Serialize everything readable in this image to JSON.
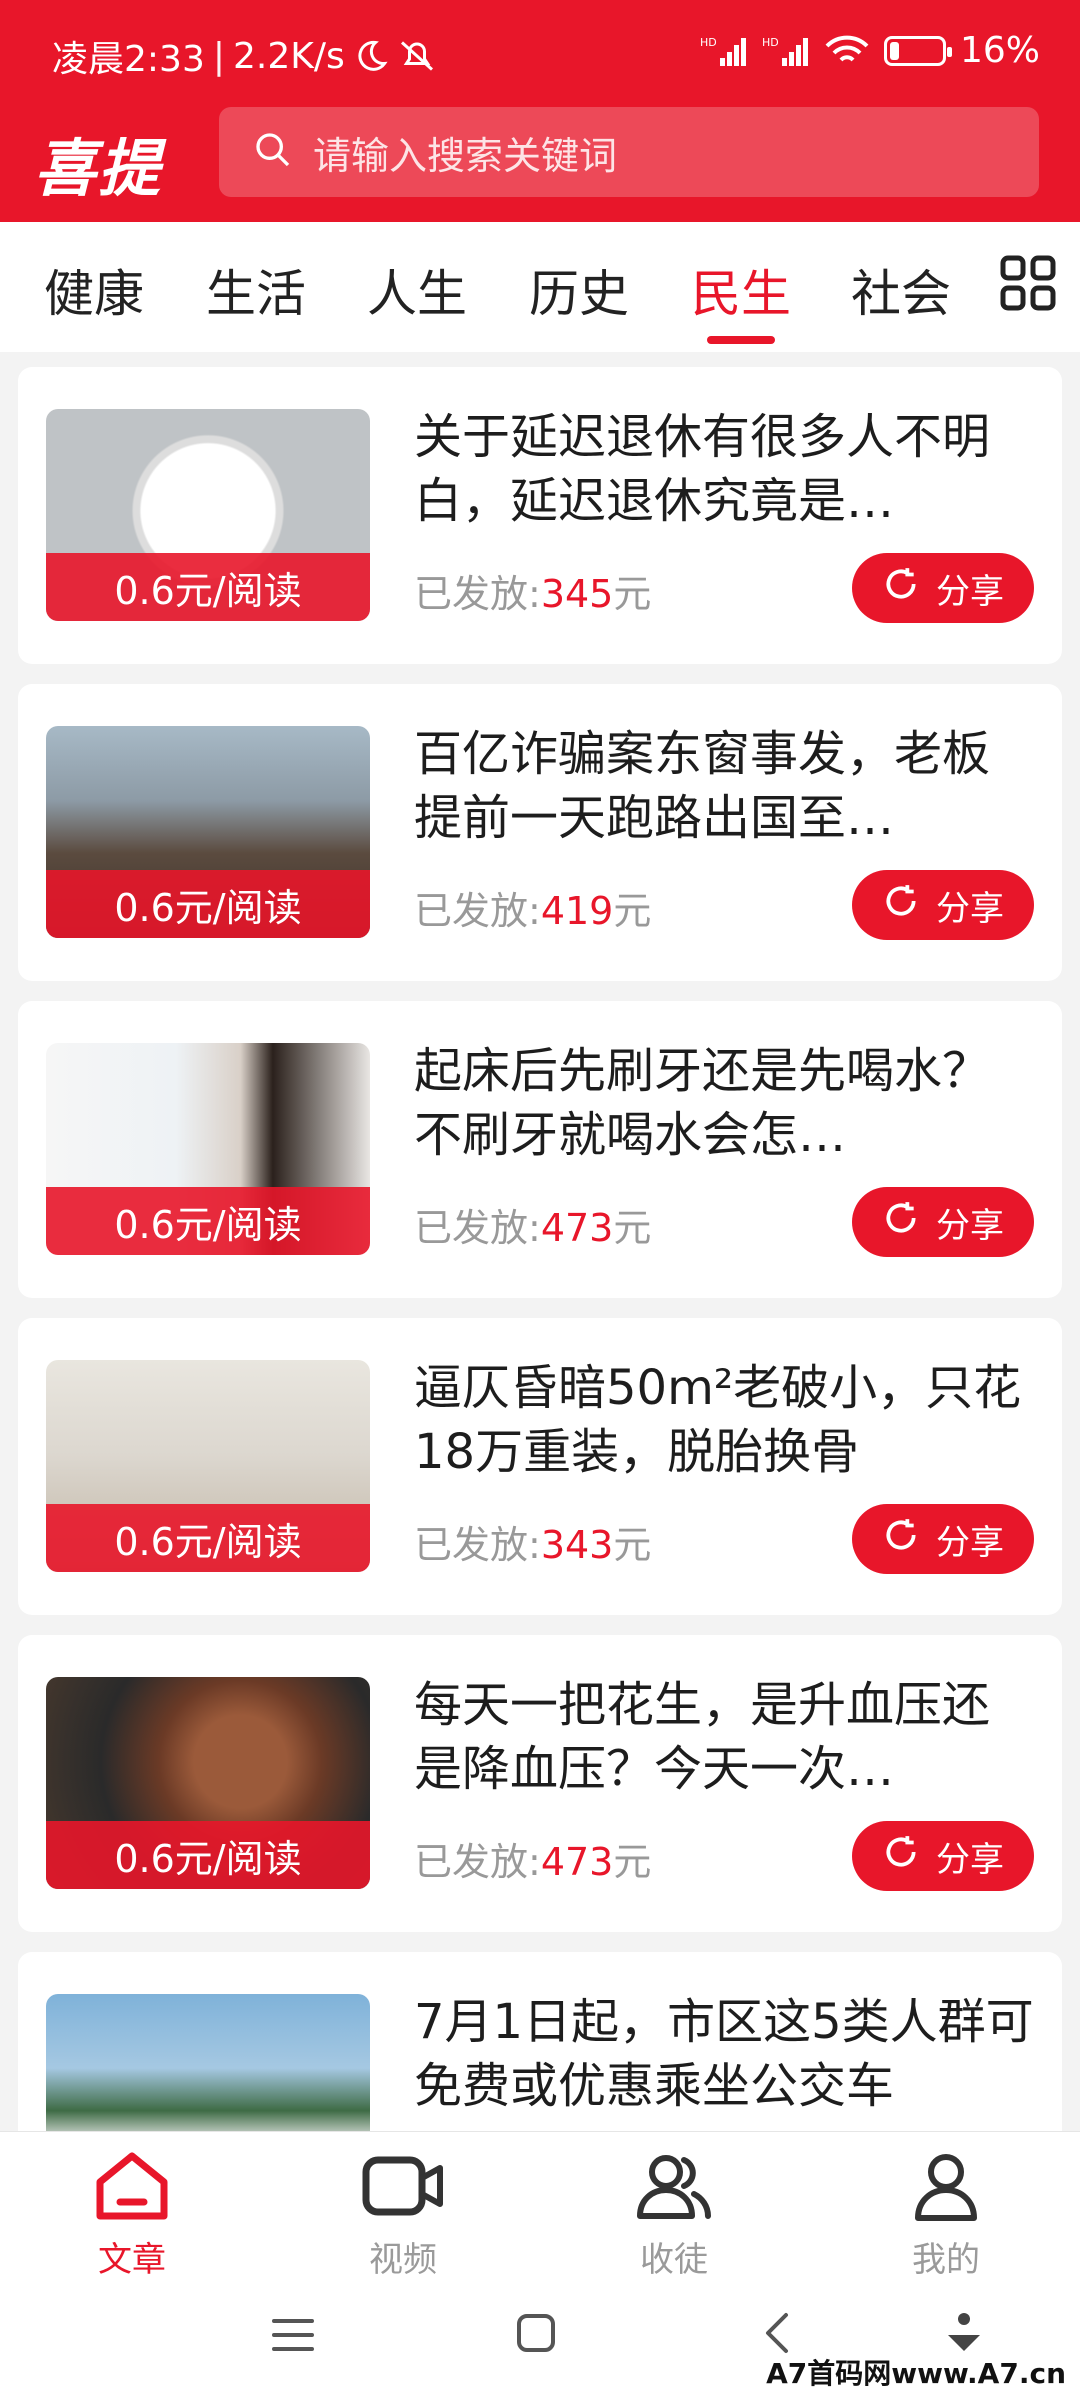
{
  "status_bar": {
    "time": "凌晨2:33",
    "speed": "2.2K/s",
    "signal1": "HD",
    "signal2": "HD",
    "battery": "16%"
  },
  "header": {
    "logo": "喜提",
    "search_placeholder": "请输入搜索关键词"
  },
  "tabs": [
    {
      "label": "健康"
    },
    {
      "label": "生活"
    },
    {
      "label": "人生"
    },
    {
      "label": "历史"
    },
    {
      "label": "民生",
      "active": true
    },
    {
      "label": "社会"
    }
  ],
  "articles": [
    {
      "title": "关于延迟退休有很多人不明白，延迟退休究竟是…",
      "price": "0.6元/阅读",
      "paid_label": "已发放:",
      "paid_amount": "345",
      "paid_unit": "元",
      "share": "分享"
    },
    {
      "title": "百亿诈骗案东窗事发，老板提前一天跑路出国至…",
      "price": "0.6元/阅读",
      "paid_label": "已发放:",
      "paid_amount": "419",
      "paid_unit": "元",
      "share": "分享"
    },
    {
      "title": "起床后先刷牙还是先喝水？不刷牙就喝水会怎…",
      "price": "0.6元/阅读",
      "paid_label": "已发放:",
      "paid_amount": "473",
      "paid_unit": "元",
      "share": "分享"
    },
    {
      "title": "逼仄昏暗50m²老破小，只花18万重装，脱胎换骨",
      "price": "0.6元/阅读",
      "paid_label": "已发放:",
      "paid_amount": "343",
      "paid_unit": "元",
      "share": "分享"
    },
    {
      "title": "每天一把花生，是升血压还是降血压？今天一次…",
      "price": "0.6元/阅读",
      "paid_label": "已发放:",
      "paid_amount": "473",
      "paid_unit": "元",
      "share": "分享"
    },
    {
      "title": "7月1日起，市区这5类人群可免费或优惠乘坐公交车"
    }
  ],
  "bottom_nav": [
    {
      "label": "文章",
      "icon": "home-icon",
      "active": true
    },
    {
      "label": "视频",
      "icon": "video-icon"
    },
    {
      "label": "收徒",
      "icon": "people-icon"
    },
    {
      "label": "我的",
      "icon": "user-icon"
    }
  ],
  "watermark": "A7首码网www.A7.cn",
  "colors": {
    "brand": "#e8162a",
    "text": "#1d1d1d",
    "muted": "#999999"
  }
}
